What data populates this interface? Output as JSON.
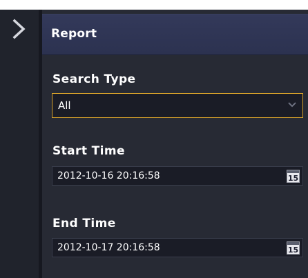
{
  "panel": {
    "title": "Report"
  },
  "search_type": {
    "label": "Search Type",
    "selected": "All"
  },
  "start_time": {
    "label": "Start Time",
    "value": "2012-10-16 20:16:58"
  },
  "end_time": {
    "label": "End Time",
    "value": "2012-10-17 20:16:58"
  },
  "calendar_icon_text": "15",
  "icons": {
    "toggle": "chevron-right-icon",
    "dropdown": "chevron-down-icon",
    "calendar": "calendar-icon"
  },
  "colors": {
    "focus_border": "#d9a32a",
    "header_bg": "#2f3554",
    "panel_bg": "#272a34"
  }
}
